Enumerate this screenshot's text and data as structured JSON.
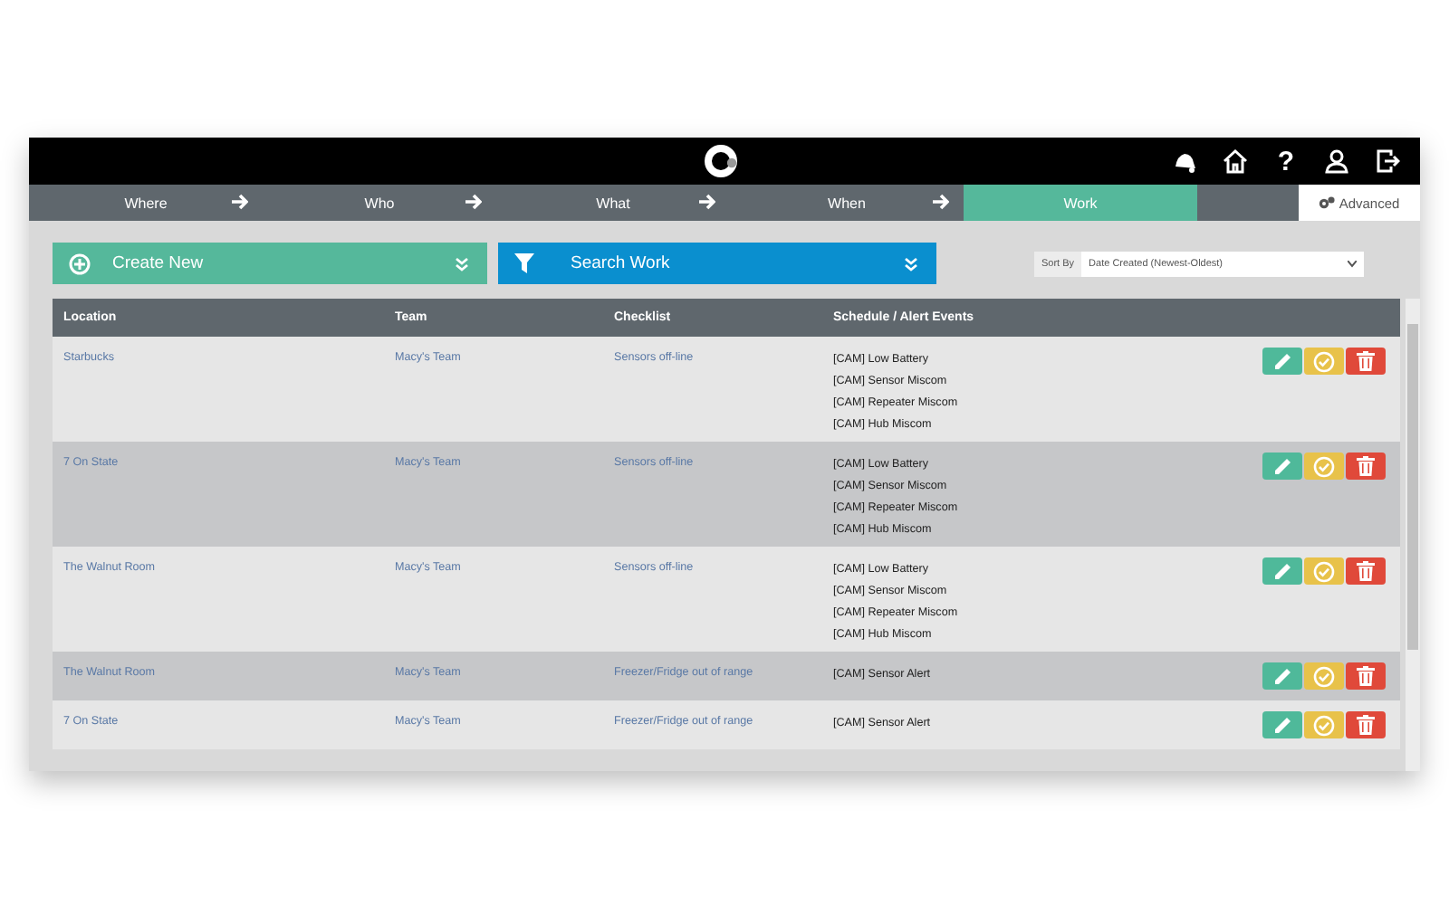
{
  "topbar": {
    "help": "?"
  },
  "steps": [
    {
      "label": "Where",
      "selected": false
    },
    {
      "label": "Who",
      "selected": false
    },
    {
      "label": "What",
      "selected": false
    },
    {
      "label": "When",
      "selected": false
    },
    {
      "label": "Work",
      "selected": true
    }
  ],
  "advanced": "Advanced",
  "actions": {
    "create": "Create New",
    "search": "Search Work"
  },
  "sort": {
    "label": "Sort By",
    "value": "Date Created (Newest-Oldest)"
  },
  "table": {
    "columns": [
      "Location",
      "Team",
      "Checklist",
      "Schedule / Alert Events"
    ],
    "rows": [
      {
        "location": "Starbucks",
        "team": "Macy's Team",
        "checklist": "Sensors off-line",
        "events": [
          "[CAM] Low Battery",
          "[CAM] Sensor Miscom",
          "[CAM] Repeater Miscom",
          "[CAM] Hub Miscom"
        ]
      },
      {
        "location": "7 On State",
        "team": "Macy's Team",
        "checklist": "Sensors off-line",
        "events": [
          "[CAM] Low Battery",
          "[CAM] Sensor Miscom",
          "[CAM] Repeater Miscom",
          "[CAM] Hub Miscom"
        ]
      },
      {
        "location": "The Walnut Room",
        "team": "Macy's Team",
        "checklist": "Sensors off-line",
        "events": [
          "[CAM] Low Battery",
          "[CAM] Sensor Miscom",
          "[CAM] Repeater Miscom",
          "[CAM] Hub Miscom"
        ]
      },
      {
        "location": "The Walnut Room",
        "team": "Macy's Team",
        "checklist": "Freezer/Fridge out of range",
        "events": [
          "[CAM] Sensor Alert"
        ]
      },
      {
        "location": "7 On State",
        "team": "Macy's Team",
        "checklist": "Freezer/Fridge out of range",
        "events": [
          "[CAM] Sensor Alert"
        ]
      }
    ]
  }
}
